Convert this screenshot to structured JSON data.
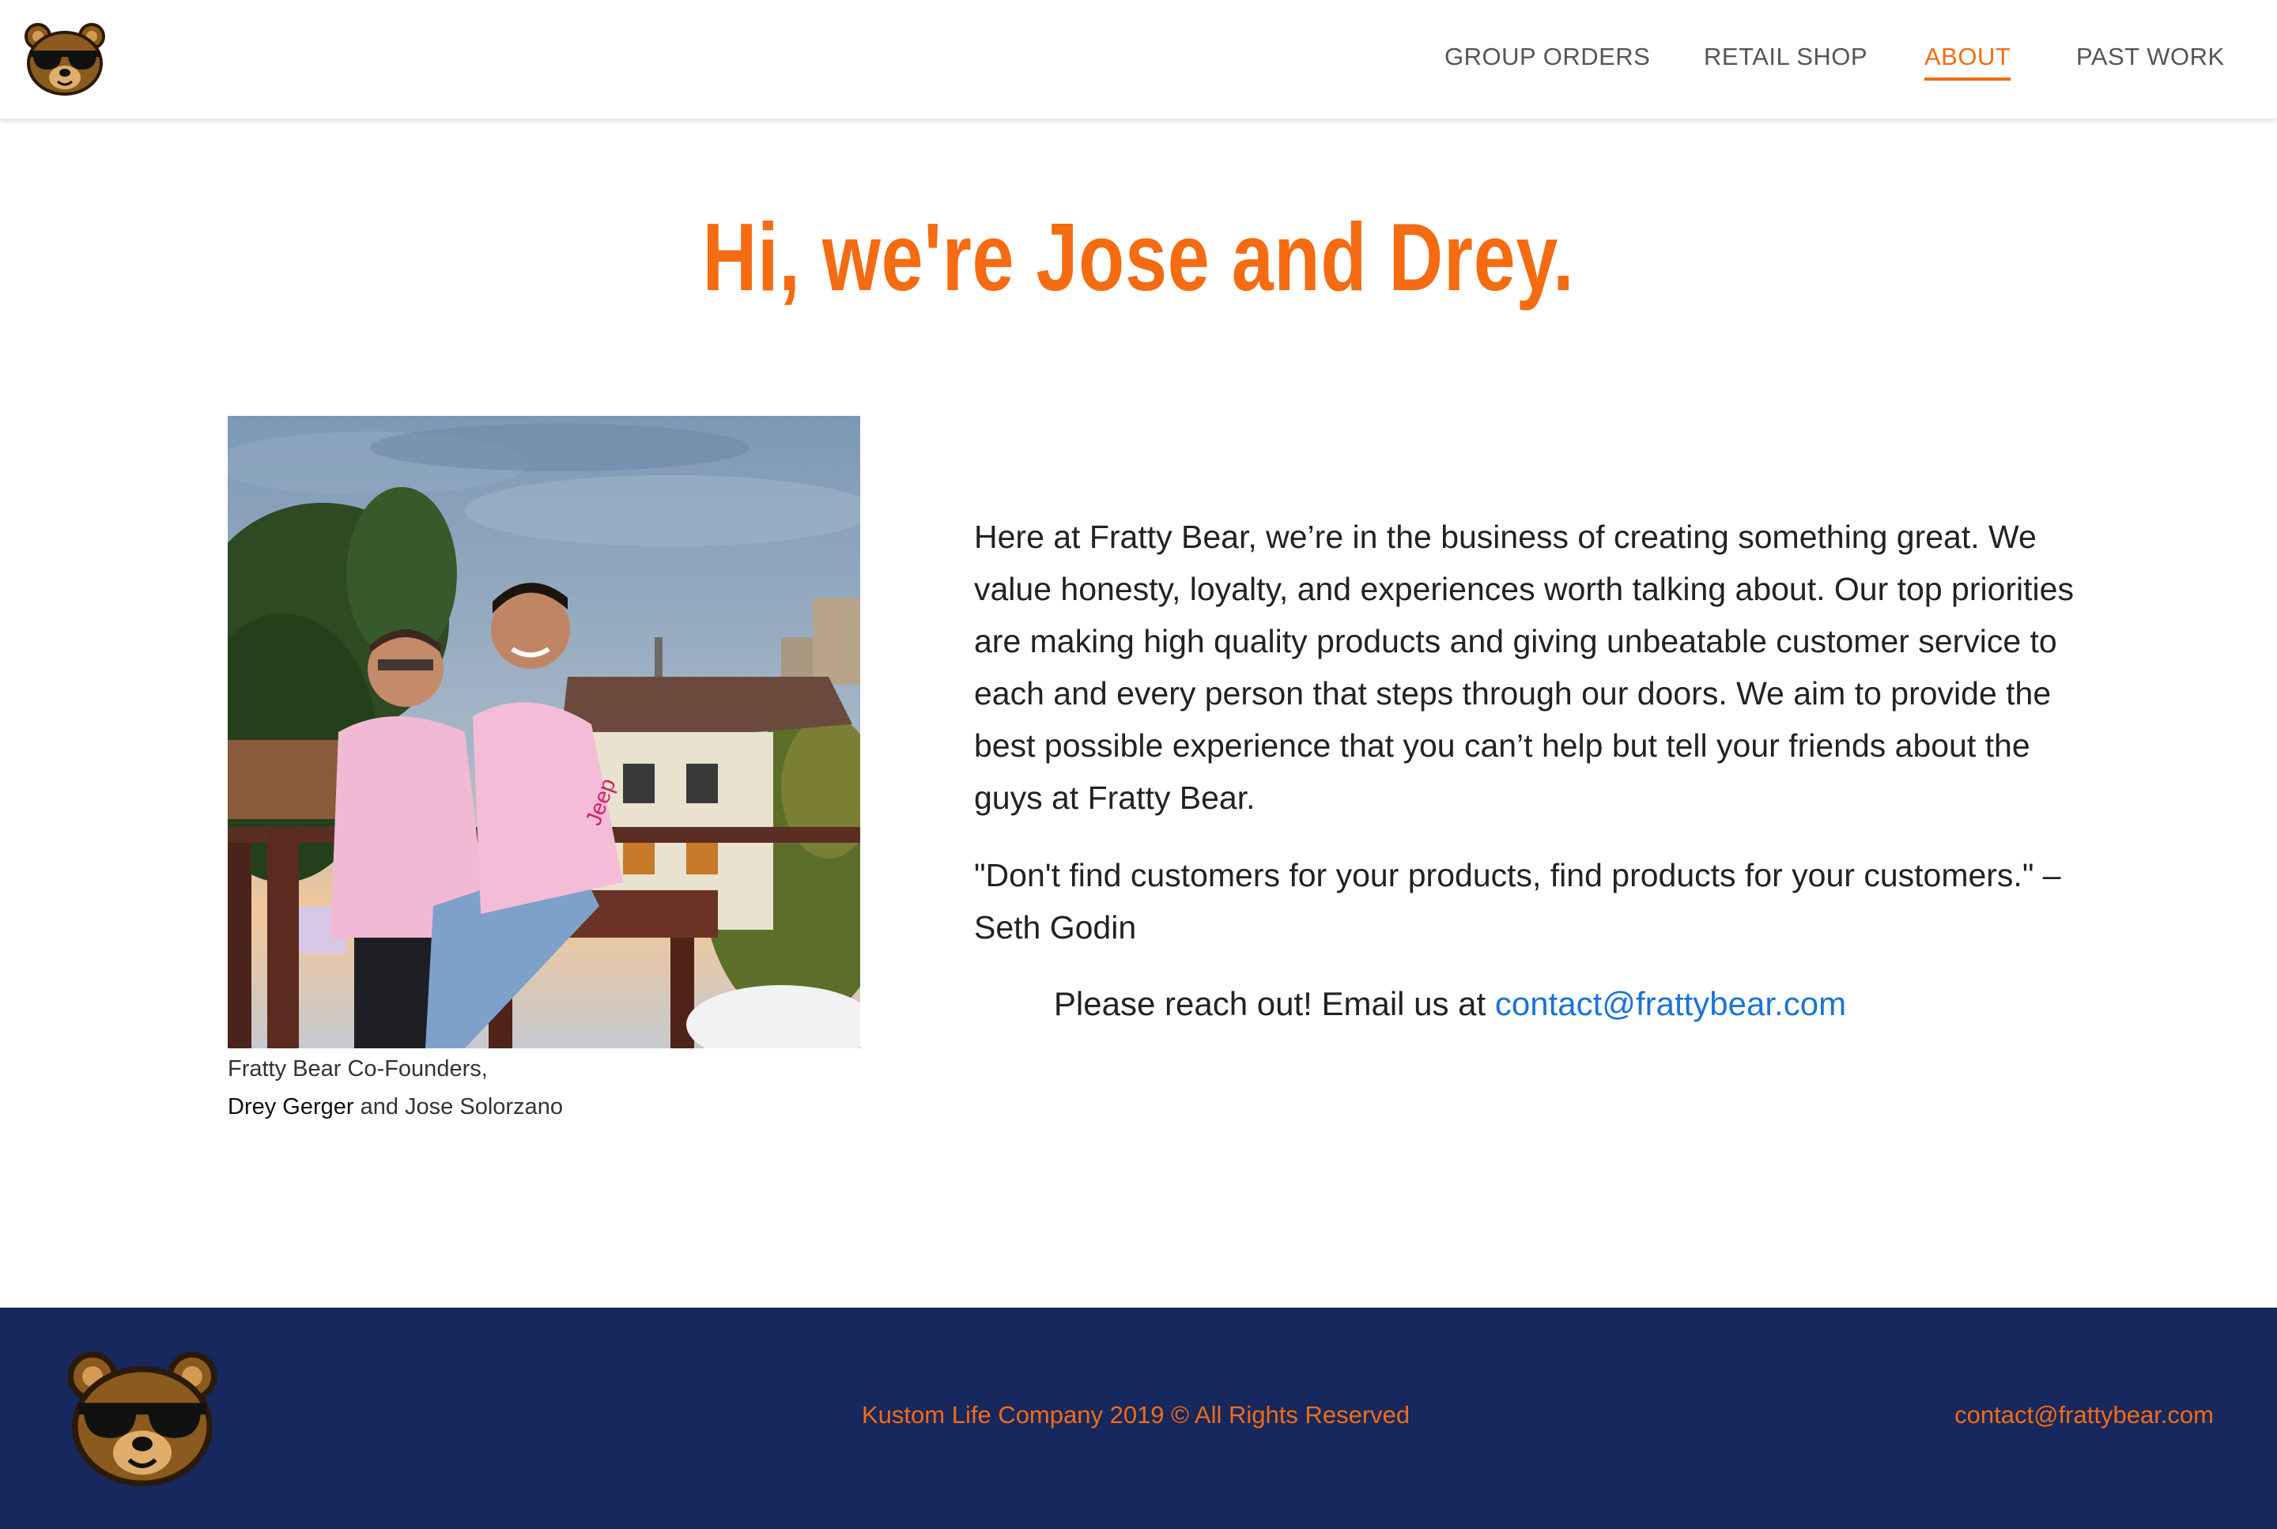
{
  "header": {
    "logo_icon": "bear-sunglasses-logo-icon",
    "nav": [
      {
        "label": "GROUP ORDERS",
        "active": false
      },
      {
        "label": "RETAIL SHOP",
        "active": false
      },
      {
        "label": "ABOUT",
        "active": true
      },
      {
        "label": "PAST WORK",
        "active": false
      }
    ]
  },
  "main": {
    "title": "Hi, we're Jose and Drey.",
    "photo_icon": "founders-photo",
    "caption": {
      "line1": "Fratty Bear Co-Founders,",
      "name1": "Drey Gerger",
      "rest": " and Jose Solorzano"
    },
    "paragraph": "Here at Fratty Bear, we’re in the business of creating something great. We value honesty, loyalty, and experiences worth talking about. Our top priorities are making high quality products and giving unbeatable customer service to each and every person that steps through our doors. We aim to provide the best possible experience that you can’t help but tell your friends about the guys at Fratty Bear.",
    "quote": "\"Don't find customers for your products, find products for your customers.\" – Seth Godin",
    "contact_prefix": "Please reach out! Email us at ",
    "contact_email": "contact@frattybear.com"
  },
  "footer": {
    "logo_icon": "bear-sunglasses-logo-icon",
    "copyright": "Kustom Life Company 2019 © All Rights Reserved",
    "email": "contact@frattybear.com"
  },
  "colors": {
    "accent": "#f46b12",
    "footer_bg": "#16285e",
    "link": "#1a73d9",
    "nav_text": "#555555"
  }
}
